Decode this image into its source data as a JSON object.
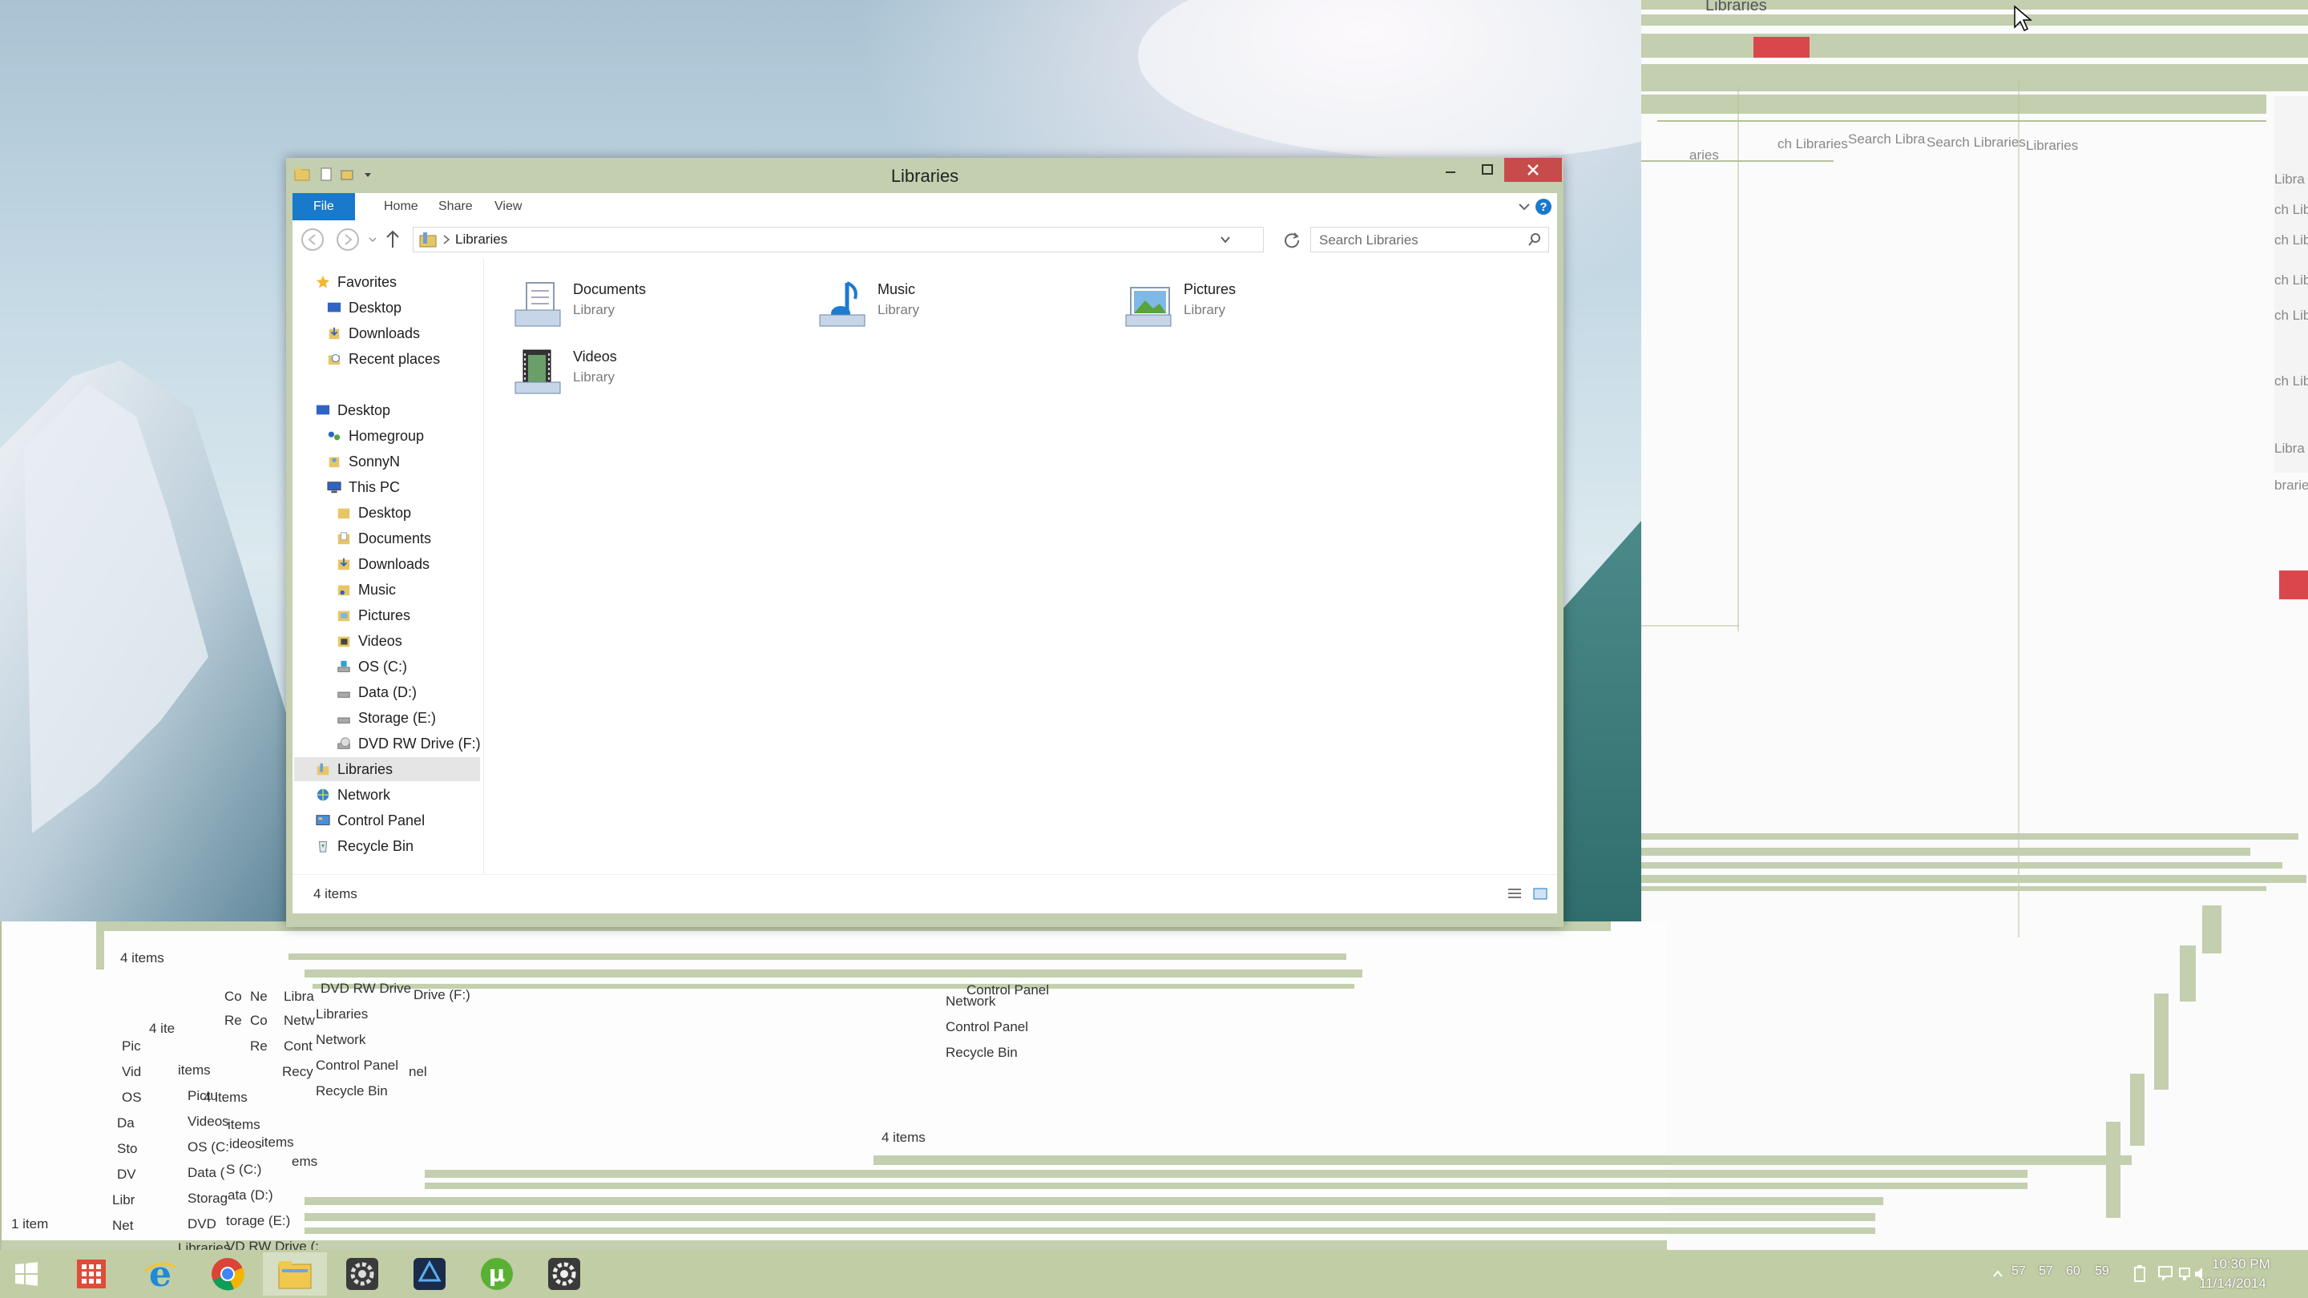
{
  "window": {
    "title": "Libraries",
    "ribbon_tabs": [
      "File",
      "Home",
      "Share",
      "View"
    ],
    "breadcrumb": "Libraries",
    "search_placeholder": "Search Libraries",
    "status": "4 items"
  },
  "nav": {
    "favorites": "Favorites",
    "favorites_items": [
      "Desktop",
      "Downloads",
      "Recent places"
    ],
    "desktop": "Desktop",
    "homegroup": "Homegroup",
    "user": "SonnyN",
    "this_pc": "This PC",
    "pc_items": [
      "Desktop",
      "Documents",
      "Downloads",
      "Music",
      "Pictures",
      "Videos",
      "OS (C:)",
      "Data (D:)",
      "Storage (E:)",
      "DVD RW Drive (F:)"
    ],
    "libraries": "Libraries",
    "network": "Network",
    "control_panel": "Control Panel",
    "recycle_bin": "Recycle Bin"
  },
  "libraries": [
    {
      "name": "Documents",
      "type": "Library",
      "icon": "documents-library-icon"
    },
    {
      "name": "Music",
      "type": "Library",
      "icon": "music-library-icon"
    },
    {
      "name": "Pictures",
      "type": "Library",
      "icon": "pictures-library-icon"
    },
    {
      "name": "Videos",
      "type": "Library",
      "icon": "videos-library-icon"
    }
  ],
  "ghost": {
    "search_a": "ch Libraries",
    "search_b": "Search Libra",
    "search_c": "Search Libraries",
    "search_d": "Libraries",
    "partial_a": "aries",
    "title_top": "Libraries",
    "side_snippets": [
      "Libra",
      "ch Lib",
      "ch Lib",
      "ch Lib",
      "ch Lib",
      "ch Lib",
      "Libra",
      "braries"
    ],
    "status_a": "4 items",
    "status_b": "4 items",
    "bottom_list": [
      "DVD RW Drive",
      "Libraries",
      "Network",
      "Control Panel",
      "Recycle Bin"
    ],
    "mid_list": [
      "Control Panel",
      "Network",
      "Control Panel",
      "Recycle Bin"
    ],
    "drive_text": "Drive (F:)",
    "left_fragments": [
      "Co",
      "Ne",
      "Libra",
      "Netw",
      "Re",
      "Co",
      "Re",
      "Cont",
      "Pic",
      "Vid",
      "OS",
      "Da",
      "Sto",
      "DV",
      "Libr",
      "Net",
      "Pictu",
      "Videos",
      "OS (C:",
      "Data (",
      "Storag",
      "DVD",
      "Libraries",
      "ideos",
      "S (C:)",
      "ata (D:)",
      "torage (E:)",
      "VD RW Drive (:",
      "items",
      "items",
      "items",
      "ems",
      "4 ite",
      "4 items",
      "1 item",
      "Recy",
      "nel"
    ]
  },
  "taskbar": {
    "apps": [
      "start-icon",
      "apps-icon",
      "internet-explorer-icon",
      "chrome-icon",
      "file-explorer-icon",
      "gear-app-icon",
      "blender-icon",
      "utorrent-icon",
      "gear-app-icon-2"
    ],
    "time": "10:30 PM",
    "date": "11/14/2014",
    "tray_values": [
      "57",
      "57",
      "60",
      "59"
    ]
  },
  "colors": {
    "accent": "#1979ca",
    "frame": "#c3cfae",
    "close": "#c84b4b"
  }
}
